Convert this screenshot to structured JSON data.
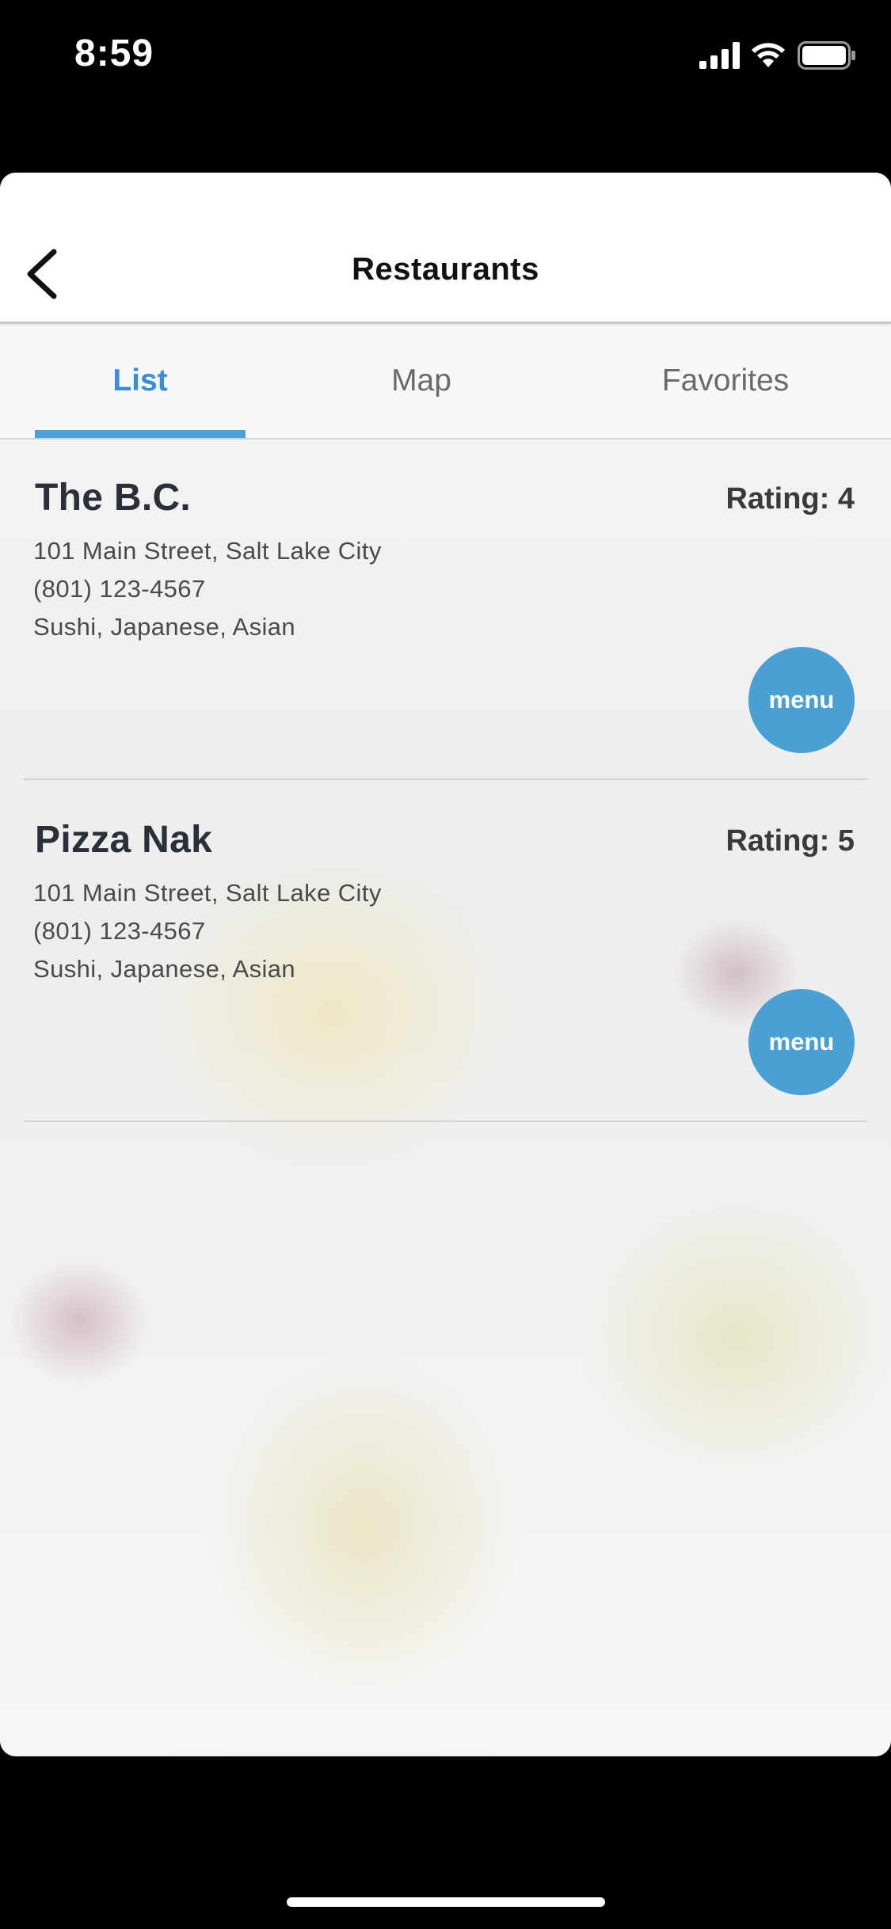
{
  "status_bar": {
    "time": "8:59"
  },
  "header": {
    "title": "Restaurants"
  },
  "tabs": [
    {
      "label": "List",
      "active": true
    },
    {
      "label": "Map",
      "active": false
    },
    {
      "label": "Favorites",
      "active": false
    }
  ],
  "restaurants": [
    {
      "name": "The B.C.",
      "rating": "Rating: 4",
      "address": "101 Main Street, Salt Lake City",
      "phone": "(801) 123-4567",
      "cuisine": "Sushi, Japanese, Asian",
      "menu_label": "menu"
    },
    {
      "name": "Pizza Nak",
      "rating": "Rating: 5",
      "address": "101 Main Street, Salt Lake City",
      "phone": "(801) 123-4567",
      "cuisine": "Sushi, Japanese, Asian",
      "menu_label": "menu"
    }
  ],
  "colors": {
    "accent": "#4aa0d8",
    "active_tab_text": "#3a8ddc",
    "menu_button": "#4aa0d3"
  },
  "icons": {
    "back": "chevron-left-icon",
    "signal": "cellular-signal-icon",
    "wifi": "wifi-icon",
    "battery": "battery-icon"
  }
}
